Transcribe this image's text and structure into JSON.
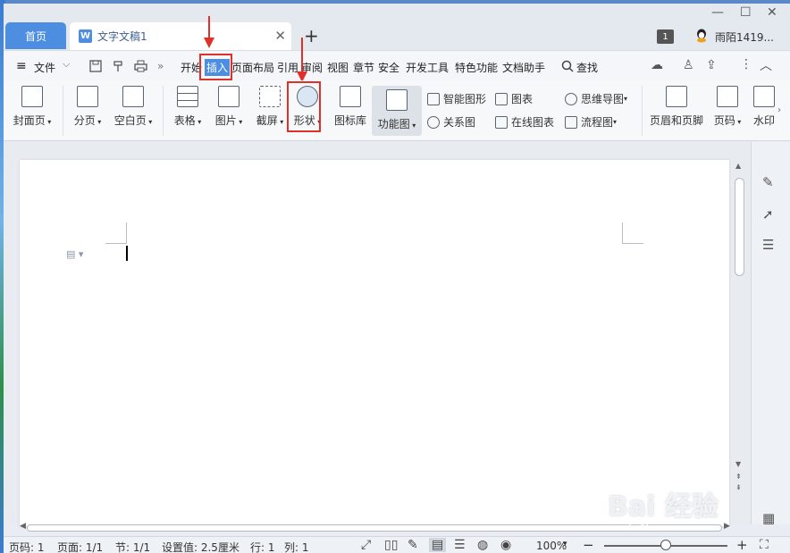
{
  "titlebar": {
    "home_tab": "首页",
    "doc_tab": "文字文稿1",
    "doc_icon": "W",
    "close_glyph": "✕",
    "add_glyph": "+",
    "badge": "1",
    "username": "雨陌1419...",
    "minimize": "—",
    "maximize": "☐",
    "close": "✕"
  },
  "menu": {
    "file": "文件",
    "items": [
      "开始",
      "插入",
      "页面布局",
      "引用",
      "审阅",
      "视图",
      "章节",
      "安全",
      "开发工具",
      "特色功能",
      "文档助手"
    ],
    "active": "插入",
    "search": "查找"
  },
  "ribbon": {
    "cover": "封面页",
    "pagebreak": "分页",
    "blankpage": "空白页",
    "table": "表格",
    "picture": "图片",
    "screenshot": "截屏",
    "shape": "形状",
    "iconlib": "图标库",
    "funcchart": "功能图",
    "smartart": "智能图形",
    "chart": "图表",
    "mindmap": "思维导图",
    "relation": "关系图",
    "onlinechart": "在线图表",
    "flowchart": "流程图",
    "headerfooter": "页眉和页脚",
    "pagenum": "页码",
    "watermark": "水印"
  },
  "status": {
    "page_code": "页码: 1",
    "pages": "页面: 1/1",
    "section": "节: 1/1",
    "setting": "设置值: 2.5厘米",
    "row": "行: 1",
    "col": "列: 1",
    "zoom": "100%",
    "zoom_level": 0.5
  },
  "watermark": {
    "logo": "Bai 经验",
    "url": "jingyan.baidu.com"
  },
  "colors": {
    "accent": "#4d8ee0",
    "highlight_red": "#e0302a"
  }
}
